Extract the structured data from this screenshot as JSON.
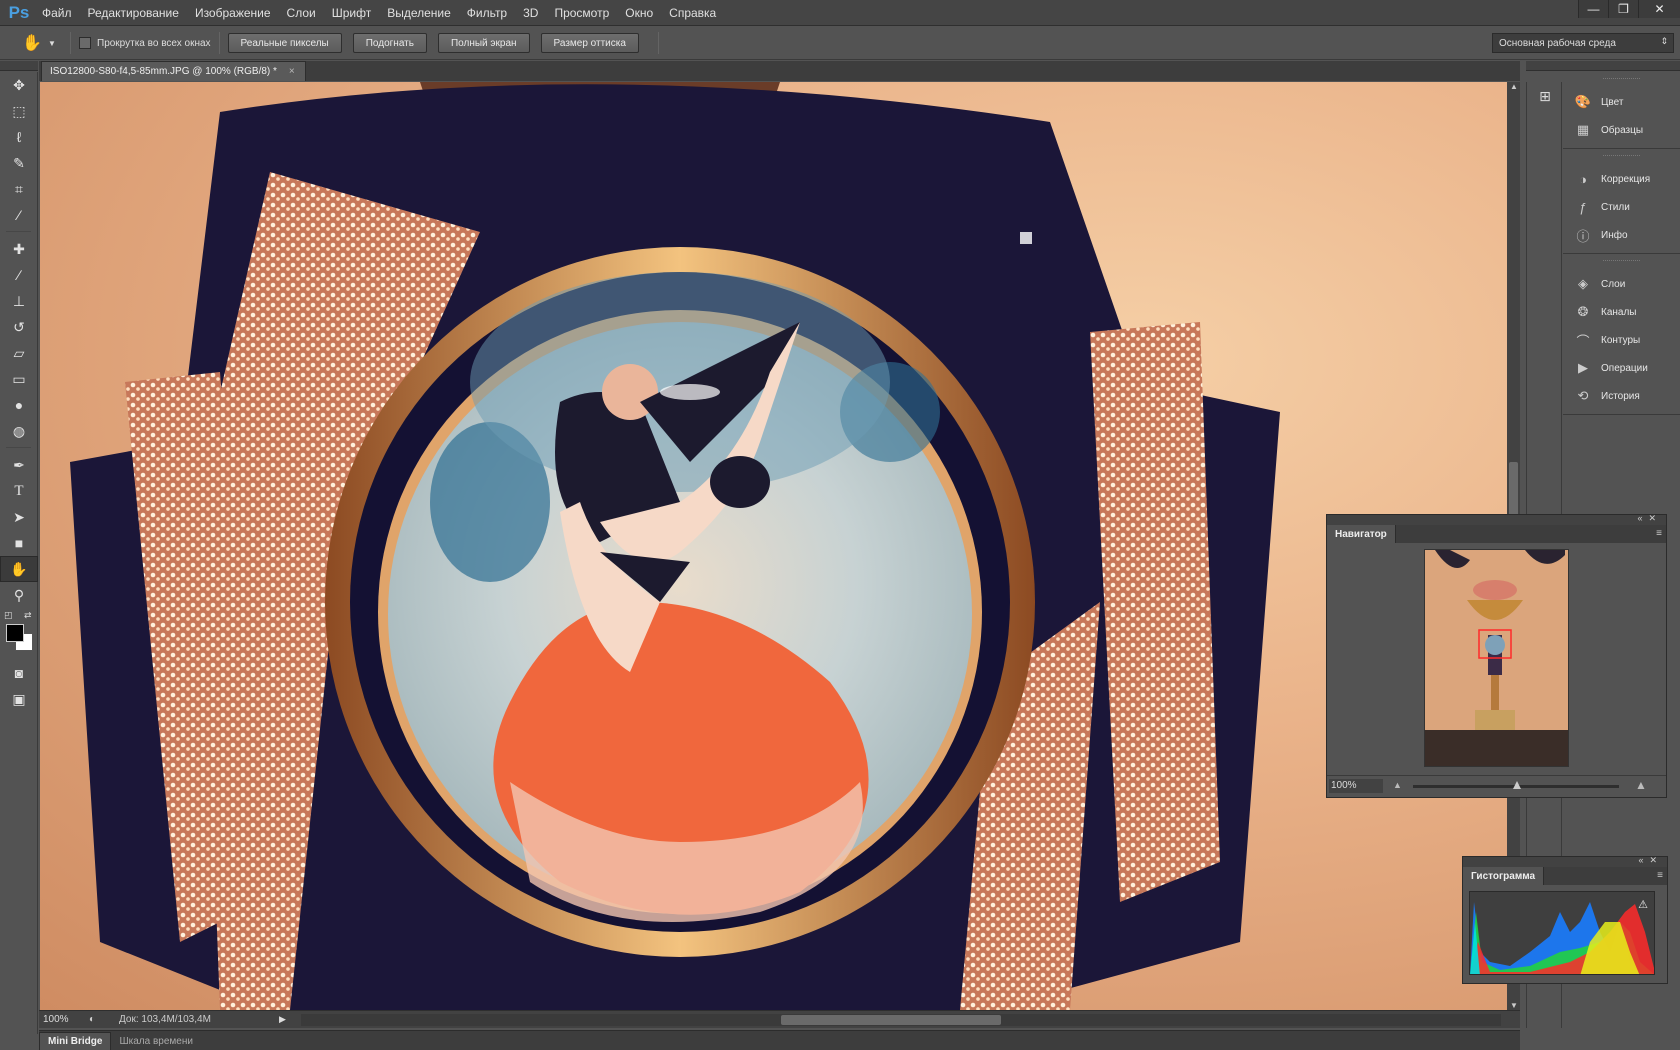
{
  "app": {
    "logo": "Ps",
    "menu": [
      "Файл",
      "Редактирование",
      "Изображение",
      "Слои",
      "Шрифт",
      "Выделение",
      "Фильтр",
      "3D",
      "Просмотр",
      "Окно",
      "Справка"
    ],
    "window_controls": [
      "—",
      "❐",
      "✕"
    ]
  },
  "options": {
    "scroll_all_label": "Прокрутка во всех окнах",
    "buttons": [
      "Реальные пикселы",
      "Подогнать",
      "Полный экран",
      "Размер оттиска"
    ],
    "workspace": "Основная рабочая среда"
  },
  "document": {
    "tab_title": "ISO12800-S80-f4,5-85mm.JPG @ 100% (RGB/8) *",
    "close_glyph": "×"
  },
  "status": {
    "zoom": "100%",
    "doc_info": "Док: 103,4M/103,4M"
  },
  "bottom_tabs": [
    "Mini Bridge",
    "Шкала времени"
  ],
  "panels": {
    "group1": [
      {
        "label": "Цвет",
        "icon": "color-icon"
      },
      {
        "label": "Образцы",
        "icon": "swatches-icon"
      }
    ],
    "group2": [
      {
        "label": "Коррекция",
        "icon": "adjustments-icon"
      },
      {
        "label": "Стили",
        "icon": "styles-icon"
      },
      {
        "label": "Инфо",
        "icon": "info-icon"
      }
    ],
    "group3": [
      {
        "label": "Слои",
        "icon": "layers-icon"
      },
      {
        "label": "Каналы",
        "icon": "channels-icon"
      },
      {
        "label": "Контуры",
        "icon": "paths-icon"
      },
      {
        "label": "Операции",
        "icon": "actions-icon"
      },
      {
        "label": "История",
        "icon": "history-icon"
      }
    ]
  },
  "navigator": {
    "title": "Навигатор",
    "zoom": "100%"
  },
  "histogram": {
    "title": "Гистограмма"
  },
  "colors": {
    "foreground": "#000000",
    "background": "#ffffff",
    "accent": "#4a9fe0"
  }
}
